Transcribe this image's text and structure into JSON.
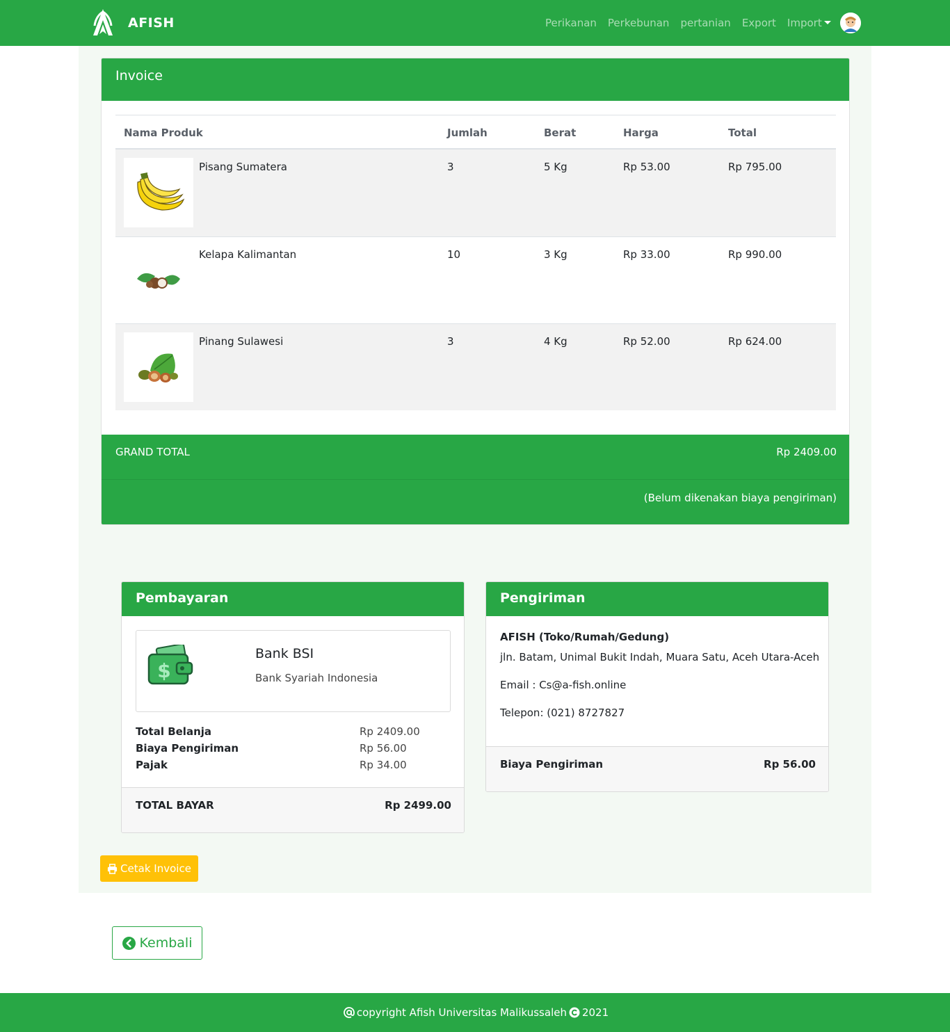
{
  "navbar": {
    "brand": "AFISH",
    "links": [
      "Perikanan",
      "Perkebunan",
      "pertanian",
      "Export",
      "Import"
    ]
  },
  "invoice": {
    "title": "Invoice",
    "columns": [
      "Nama Produk",
      "Jumlah",
      "Berat",
      "Harga",
      "Total"
    ],
    "rows": [
      {
        "name": "Pisang Sumatera",
        "qty": "3",
        "weight": "5 Kg",
        "price": "Rp 53.00",
        "total": "Rp 795.00",
        "image": "banana-image"
      },
      {
        "name": "Kelapa Kalimantan",
        "qty": "10",
        "weight": "3 Kg",
        "price": "Rp 33.00",
        "total": "Rp 990.00",
        "image": "coconut-image"
      },
      {
        "name": "Pinang Sulawesi",
        "qty": "3",
        "weight": "4 Kg",
        "price": "Rp 52.00",
        "total": "Rp 624.00",
        "image": "areca-nut-image"
      }
    ],
    "grand_total_label": "GRAND TOTAL",
    "grand_total_value": "Rp 2409.00",
    "note": "(Belum dikenakan biaya pengiriman)"
  },
  "payment": {
    "title": "Pembayaran",
    "bank_name": "Bank BSI",
    "bank_sub": "Bank Syariah Indonesia",
    "summary": [
      {
        "label": "Total Belanja",
        "value": "Rp 2409.00"
      },
      {
        "label": "Biaya Pengiriman",
        "value": "Rp 56.00"
      },
      {
        "label": "Pajak",
        "value": "Rp 34.00"
      }
    ],
    "total_label": "TOTAL BAYAR",
    "total_value": "Rp 2499.00"
  },
  "shipping": {
    "title": "Pengiriman",
    "company": "AFISH (Toko/Rumah/Gedung)",
    "address": "jln. Batam, Unimal Bukit Indah, Muara Satu, Aceh Utara-Aceh",
    "email": "Email : Cs@a-fish.online",
    "phone": "Telepon: (021) 8727827",
    "fee_label": "Biaya Pengiriman",
    "fee_value": "Rp 56.00"
  },
  "actions": {
    "print_label": "Cetak Invoice",
    "back_label": "Kembali"
  },
  "footer": {
    "text_before": "copyright Afish Universitas Malikussaleh",
    "year": "2021"
  },
  "colors": {
    "primary": "#28a745",
    "warning": "#ffc107"
  }
}
